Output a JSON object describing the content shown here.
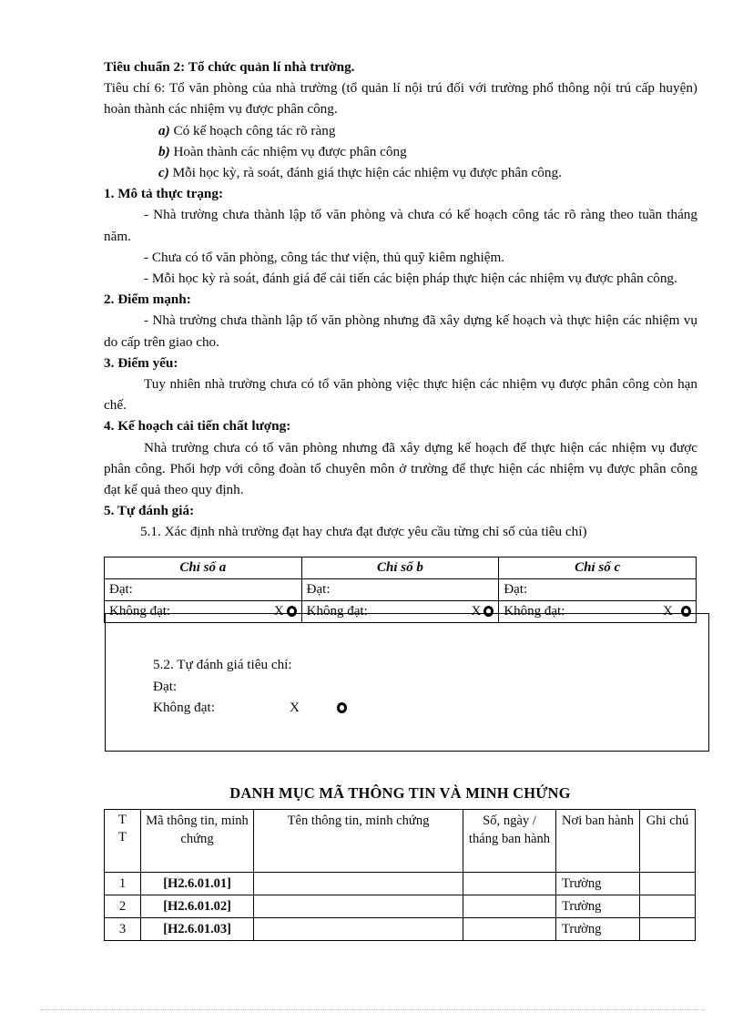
{
  "document": {
    "standard_heading": "Tiêu chuẩn 2: Tổ chức quản lí nhà trường.",
    "criterion_intro": "Tiêu chí 6: Tổ văn phòng của nhà trường (tổ quản lí nội trú đối với trường phổ thông nội trú cấp huyện) hoàn thành các nhiệm vụ được phân công.",
    "sub_items": [
      {
        "marker": "a)",
        "text": " Có kế hoạch công tác rõ ràng"
      },
      {
        "marker": "b)",
        "text": " Hoàn thành các nhiệm  vụ được phân công"
      },
      {
        "marker": "c)",
        "text": " Mỗi học kỳ, rà soát, đánh giá thực hiện các nhiệm vụ được phân công."
      }
    ],
    "sections": [
      {
        "heading": "1. Mô tả thực trạng:",
        "paragraphs": [
          "- Nhà trường chưa thành lập tổ văn phòng và chưa có kế hoạch công tác rõ ràng theo tuần tháng năm.",
          "- Chưa có tổ văn phòng, công tác thư viện, thủ quỹ kiêm nghiệm.",
          "- Mỗi học kỳ rà soát, đánh giá để cải tiến các biện pháp thực hiện các nhiệm vụ được phân công."
        ]
      },
      {
        "heading": "2. Điểm mạnh:",
        "paragraphs": [
          "- Nhà trường chưa thành lập tổ văn phòng nhưng đã xây dựng kế hoạch và thực hiện các nhiệm vụ do cấp trên giao cho."
        ]
      },
      {
        "heading": "3. Điểm yếu:",
        "paragraphs": [
          "Tuy nhiên nhà trường chưa có tổ văn phòng việc thực hiện các nhiệm vụ được phân công còn hạn chế."
        ]
      },
      {
        "heading": "4. Kế hoạch cải tiến chất lượng:",
        "paragraphs": [
          "Nhà trường chưa có tổ văn phòng nhưng đã xây dựng kế hoạch để thực hiện các nhiệm vụ được phân công. Phối hợp với  công đoàn tổ chuyên môn ở trường để thực hiện các nhiệm vụ được phân công đạt kế quả theo quy định."
        ]
      },
      {
        "heading": "5. Tự đánh giá:",
        "paragraphs": [
          "5.1. Xác định nhà trường đạt hay chưa đạt được yêu cầu từng chỉ số của tiêu chí)"
        ]
      }
    ]
  },
  "indicator_table": {
    "headers": [
      "Chỉ số a",
      "Chỉ số b",
      "Chỉ số c"
    ],
    "pass_label": "Đạt:",
    "fail_label": "Không đạt:",
    "pass_values": [
      "",
      "",
      ""
    ],
    "fail_values": [
      "X",
      "X",
      "X"
    ],
    "marker_icon": "filled-ring-marker"
  },
  "self_assessment_box": {
    "title": "5.2. Tự đánh giá tiêu chí:",
    "pass_label": "Đạt:",
    "pass_value": "",
    "fail_label": "Không đạt:",
    "fail_value": "X",
    "marker_icon": "filled-ring-marker"
  },
  "evidence": {
    "title": "DANH MỤC MÃ THÔNG TIN VÀ MINH CHỨNG",
    "headers": {
      "no_line1": "T",
      "no_line2": "T",
      "code": "Mã thông tin, minh chứng",
      "name": "Tên thông tin, minh chứng",
      "issue": "Số, ngày / tháng ban hành",
      "issuer": "Nơi ban hành",
      "note": "Ghi chú"
    },
    "rows": [
      {
        "no": "1",
        "code": "[H2.6.01.01]",
        "name": "",
        "issue": "",
        "issuer": "Trường",
        "note": ""
      },
      {
        "no": "2",
        "code": "[H2.6.01.02]",
        "name": "",
        "issue": "",
        "issuer": "Trường",
        "note": ""
      },
      {
        "no": "3",
        "code": "[H2.6.01.03]",
        "name": "",
        "issue": "",
        "issuer": "Trường",
        "note": ""
      }
    ]
  }
}
